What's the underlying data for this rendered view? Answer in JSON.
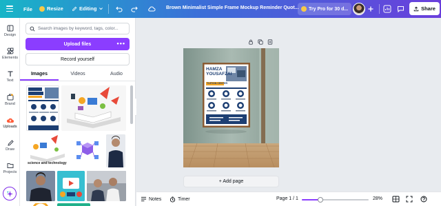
{
  "topbar": {
    "file_label": "File",
    "resize_label": "Resize",
    "editing_label": "Editing",
    "doc_title": "Brown Minimalist Simple Frame Mockup Reminder Quot...",
    "try_pro_label": "Try Pro for 30 d...",
    "share_label": "Share",
    "colors": {
      "gradient_start": "#18b5c7",
      "gradient_mid": "#3b6fd8",
      "gradient_end": "#6a3fdc"
    }
  },
  "rail": {
    "items": [
      {
        "label": "Design",
        "icon": "design-icon"
      },
      {
        "label": "Elements",
        "icon": "elements-icon"
      },
      {
        "label": "Text",
        "icon": "text-icon"
      },
      {
        "label": "Brand",
        "icon": "brand-icon"
      },
      {
        "label": "Uploads",
        "icon": "uploads-icon"
      },
      {
        "label": "Draw",
        "icon": "draw-icon"
      },
      {
        "label": "Projects",
        "icon": "projects-icon"
      }
    ],
    "active": "Uploads",
    "uploads_accent": "#ff5c39"
  },
  "panel": {
    "search_placeholder": "Search images by keyword, tags, color...",
    "upload_label": "Upload files",
    "record_label": "Record yourself",
    "tabs": [
      "Images",
      "Videos",
      "Audio"
    ],
    "active_tab": "Images",
    "thumb_caption": "science and technology",
    "accent": "#8b3dff"
  },
  "poster": {
    "name_line1": "HAMZA",
    "name_line2": "YOUSAFZAI",
    "subtitle": "TUITION CENTER"
  },
  "canvas": {
    "add_page_label": "+ Add page"
  },
  "bottombar": {
    "notes_label": "Notes",
    "timer_label": "Timer",
    "page_indicator": "Page 1 / 1",
    "zoom_label": "28%",
    "zoom_fraction": 0.28
  }
}
